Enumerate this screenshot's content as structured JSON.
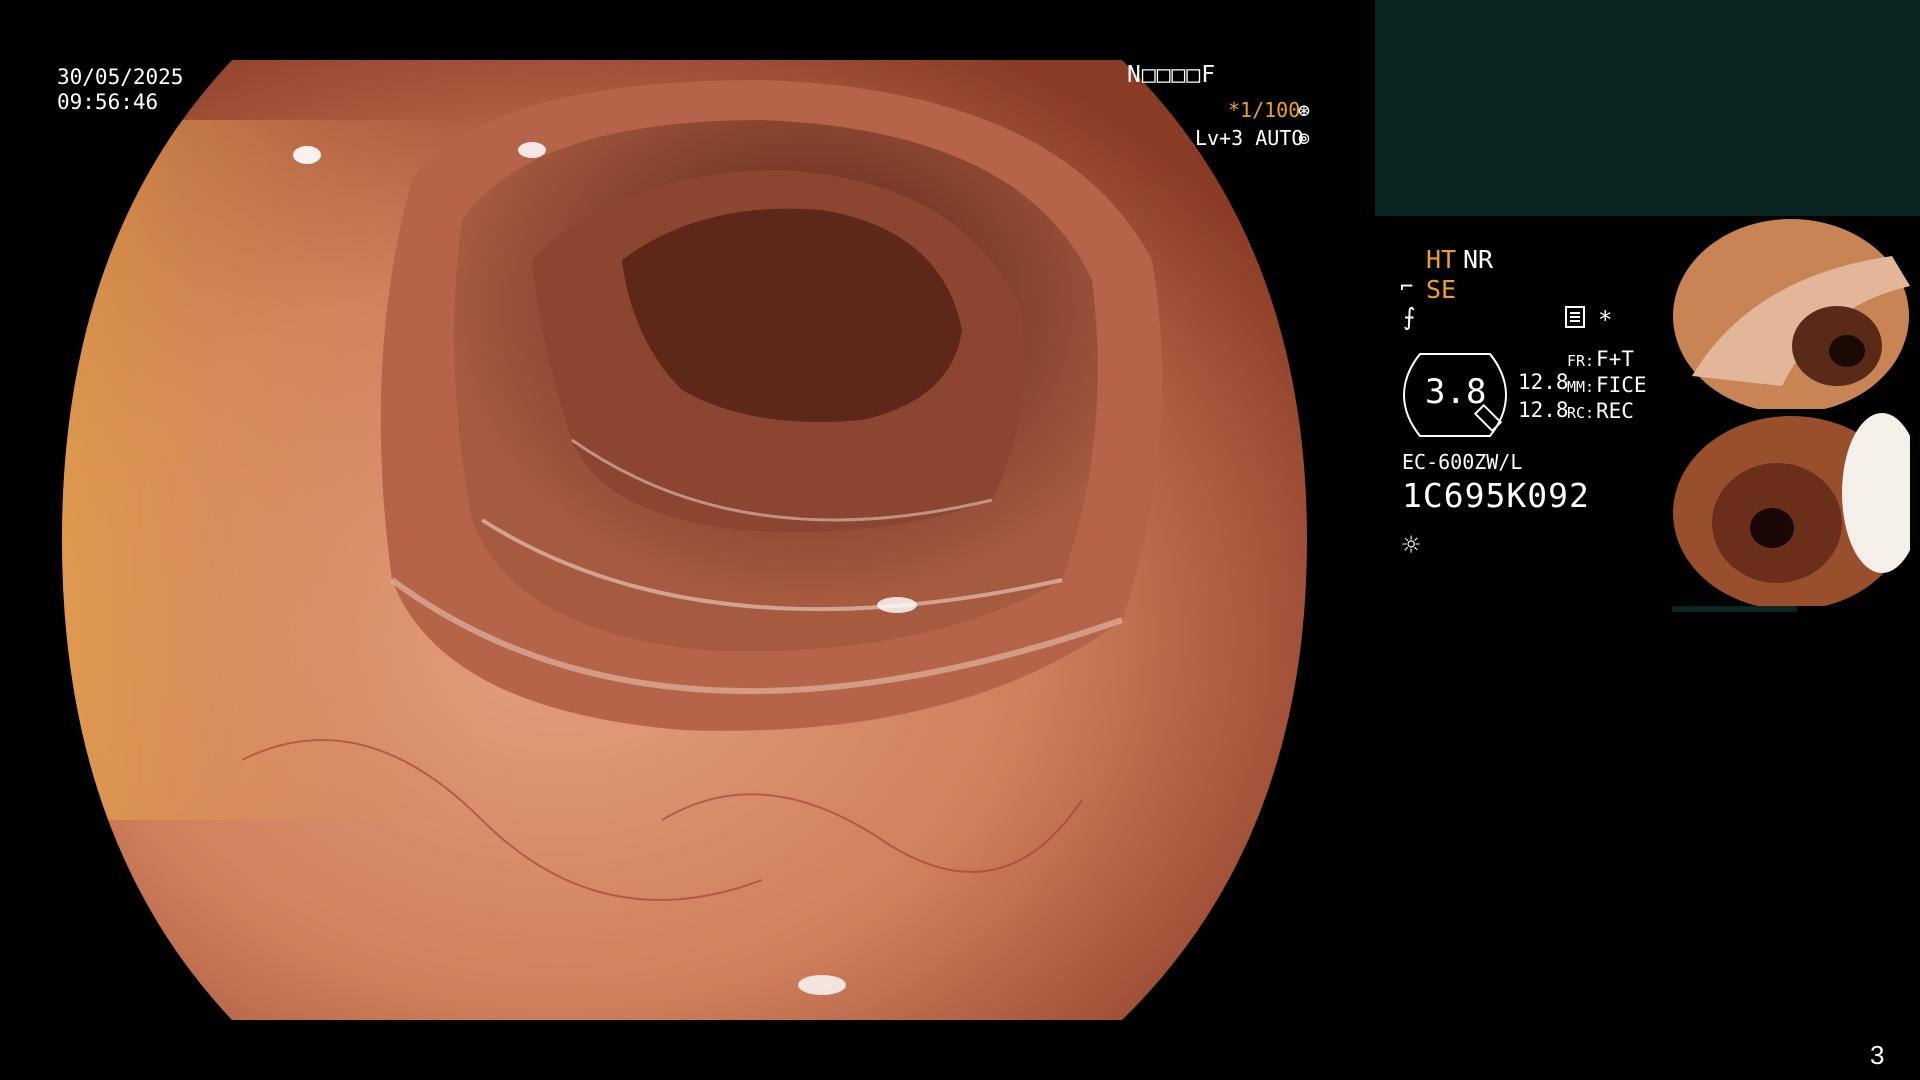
{
  "overlay": {
    "date": "30/05/2025",
    "time": "09:56:46",
    "patient_id": "N□□□□F",
    "shutter": "*1/100",
    "shutter_icon": "⊛",
    "level": "Lv+3 AUTO",
    "auto_icon": "⊚"
  },
  "panel": {
    "ht": "HT",
    "nr": "NR",
    "se_icon": "⌐",
    "se": "SE",
    "struct_icon": "⨍",
    "star_icon": "*",
    "zoom": "3.8",
    "value_1": "12.8",
    "value_2": "12.8",
    "fr_label": "FR:",
    "fr_value": "F+T",
    "mm_label": "MM:",
    "mm_value": "FICE",
    "rc_label": "RC:",
    "rc_value": "REC",
    "scope_model": "EC-600ZW/L",
    "serial": "1C695K092",
    "light_icon": "☼"
  },
  "page": {
    "number": "3"
  },
  "colors": {
    "accent": "#f0a020",
    "panel_teal": "#0a2622",
    "tissue": "#d98a6a",
    "lumen": "#3a1a12"
  },
  "icons": {
    "shutter": "shutter-icon",
    "auto": "auto-icon",
    "structure": "structure-enhance-icon",
    "monitor": "monitor-icon",
    "light": "light-icon"
  }
}
